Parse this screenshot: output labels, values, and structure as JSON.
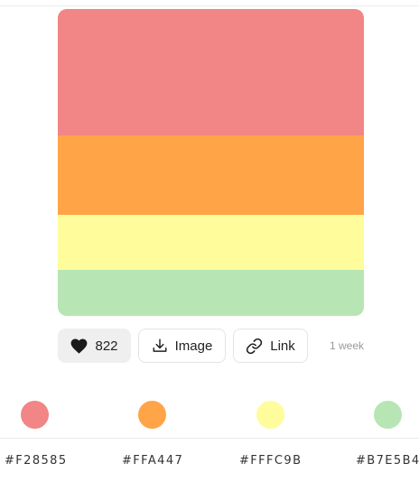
{
  "palette": {
    "colors": [
      {
        "hex": "#F28585",
        "code": "#F28585"
      },
      {
        "hex": "#FFA447",
        "code": "#FFA447"
      },
      {
        "hex": "#FFFC9B",
        "code": "#FFFC9B"
      },
      {
        "hex": "#B7E5B4",
        "code": "#B7E5B4"
      }
    ]
  },
  "actions": {
    "likes": "822",
    "image_label": "Image",
    "link_label": "Link",
    "age": "1 week"
  }
}
